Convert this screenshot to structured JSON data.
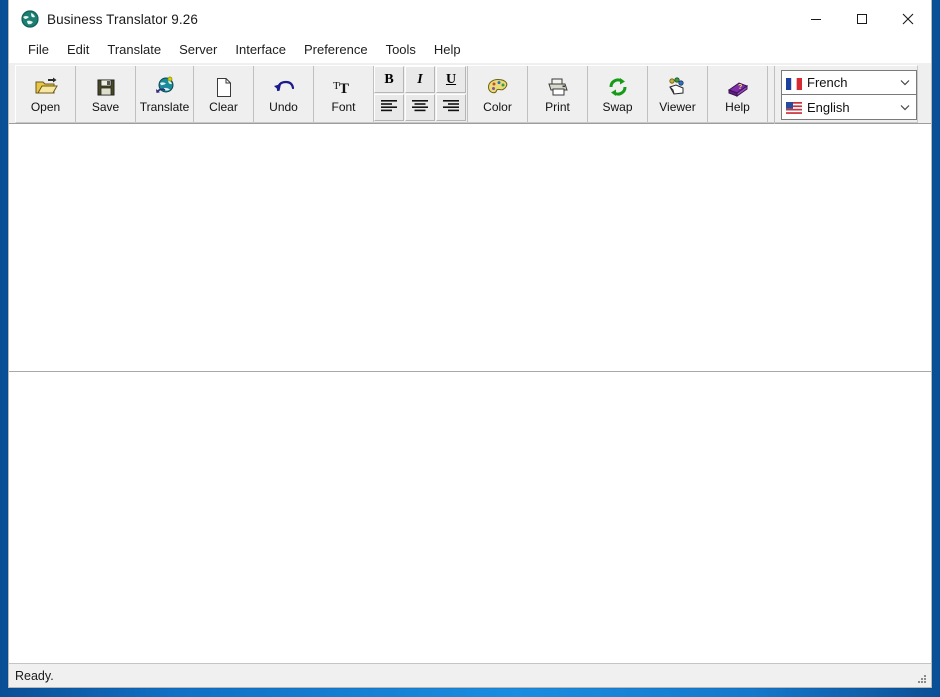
{
  "window": {
    "title": "Business Translator 9.26",
    "app_icon": "globe-icon",
    "controls": {
      "minimize": "minimize-icon",
      "maximize": "maximize-icon",
      "close": "close-icon"
    }
  },
  "menubar": {
    "items": [
      {
        "label": "File"
      },
      {
        "label": "Edit"
      },
      {
        "label": "Translate"
      },
      {
        "label": "Server"
      },
      {
        "label": "Interface"
      },
      {
        "label": "Preference"
      },
      {
        "label": "Tools"
      },
      {
        "label": "Help"
      }
    ]
  },
  "toolbar": {
    "buttons": [
      {
        "label": "Open",
        "icon": "open-folder-icon"
      },
      {
        "label": "Save",
        "icon": "floppy-disk-icon"
      },
      {
        "label": "Translate",
        "icon": "globe-translate-icon"
      },
      {
        "label": "Clear",
        "icon": "blank-page-icon"
      },
      {
        "label": "Undo",
        "icon": "undo-arrow-icon"
      },
      {
        "label": "Font",
        "icon": "font-letters-icon"
      }
    ],
    "format_buttons": [
      {
        "label": "B",
        "name": "bold-button"
      },
      {
        "label": "I",
        "name": "italic-button"
      },
      {
        "label": "U",
        "name": "underline-button"
      },
      {
        "label": "",
        "name": "align-left-button"
      },
      {
        "label": "",
        "name": "align-center-button"
      },
      {
        "label": "",
        "name": "align-right-button"
      }
    ],
    "buttons_right": [
      {
        "label": "Color",
        "icon": "color-palette-icon"
      },
      {
        "label": "Print",
        "icon": "printer-icon"
      },
      {
        "label": "Swap",
        "icon": "swap-refresh-icon"
      },
      {
        "label": "Viewer",
        "icon": "viewer-hand-icon"
      },
      {
        "label": "Help",
        "icon": "help-book-icon"
      }
    ],
    "source_language": {
      "value": "French",
      "flag": "flag-france-icon"
    },
    "target_language": {
      "value": "English",
      "flag": "flag-usa-icon"
    }
  },
  "editor": {
    "source_text": "",
    "target_text": ""
  },
  "statusbar": {
    "text": "Ready.",
    "grip": "resize-grip-icon"
  },
  "colors": {
    "window_border": "#0a65b8",
    "toolbar_bg": "#efefef",
    "pane_bg": "#ffffff",
    "statusbar_bg": "#f0f0f0"
  }
}
